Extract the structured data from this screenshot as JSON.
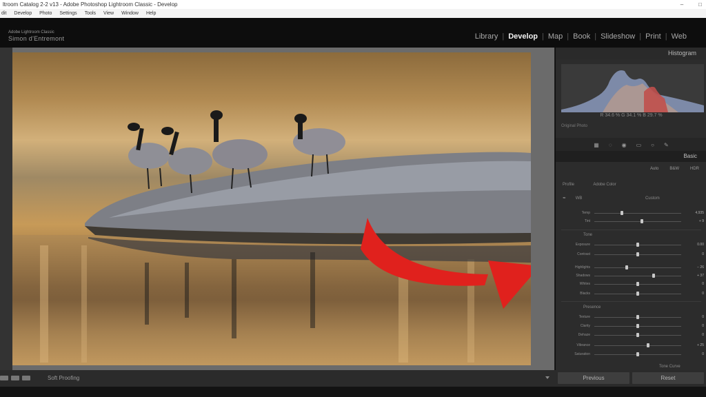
{
  "window": {
    "title": "ltroom Catalog 2-2 v13 - Adobe Photoshop Lightroom Classic - Develop",
    "controls": [
      "–",
      "□"
    ]
  },
  "menubar": [
    "dit",
    "Develop",
    "Photo",
    "Settings",
    "Tools",
    "View",
    "Window",
    "Help"
  ],
  "identity": {
    "product": "Adobe Lightroom Classic",
    "user": "Simon d'Entremont"
  },
  "modules": [
    {
      "label": "Library",
      "active": false
    },
    {
      "label": "Develop",
      "active": true
    },
    {
      "label": "Map",
      "active": false
    },
    {
      "label": "Book",
      "active": false
    },
    {
      "label": "Slideshow",
      "active": false
    },
    {
      "label": "Print",
      "active": false
    },
    {
      "label": "Web",
      "active": false
    }
  ],
  "panel": {
    "histogram_label": "Histogram",
    "hist_info": "R 34.6 % G 34.1 % B 29.7 %",
    "original_photo": "Original Photo",
    "basic_label": "Basic",
    "treatments": [
      "Auto",
      "B&W",
      "HDR"
    ],
    "profile_label": "Profile",
    "profile_value": "Adobe Color",
    "wb_label": "WB",
    "wb_value": "Custom",
    "groups": [
      {
        "title": "",
        "rows": [
          {
            "label": "Temp",
            "value": "4,935",
            "pos": 0.32
          },
          {
            "label": "Tint",
            "value": "+ 9",
            "pos": 0.55
          }
        ]
      },
      {
        "title": "Tone",
        "rows": [
          {
            "label": "Exposure",
            "value": "0.00",
            "pos": 0.5
          },
          {
            "label": "Contrast",
            "value": "0",
            "pos": 0.5
          },
          {
            "label": "Highlights",
            "value": "− 26",
            "pos": 0.37
          },
          {
            "label": "Shadows",
            "value": "+ 37",
            "pos": 0.68
          },
          {
            "label": "Whites",
            "value": "0",
            "pos": 0.5
          },
          {
            "label": "Blacks",
            "value": "0",
            "pos": 0.5
          }
        ]
      },
      {
        "title": "Presence",
        "rows": [
          {
            "label": "Texture",
            "value": "0",
            "pos": 0.5
          },
          {
            "label": "Clarity",
            "value": "0",
            "pos": 0.5
          },
          {
            "label": "Dehaze",
            "value": "0",
            "pos": 0.5
          },
          {
            "label": "Vibrance",
            "value": "+ 25",
            "pos": 0.62
          },
          {
            "label": "Saturation",
            "value": "0",
            "pos": 0.5
          }
        ]
      }
    ],
    "next_section": "Tone Curve"
  },
  "bottom": {
    "soft_proofing": "Soft Proofing"
  },
  "buttons": {
    "previous": "Previous",
    "reset": "Reset"
  },
  "colors": {
    "arrow": "#e0211d",
    "accent_active": "#f2f2f2"
  },
  "icons": [
    "crop-icon",
    "spot-removal-icon",
    "red-eye-icon",
    "graduated-filter-icon",
    "radial-filter-icon",
    "brush-icon",
    "eyedropper-icon"
  ]
}
